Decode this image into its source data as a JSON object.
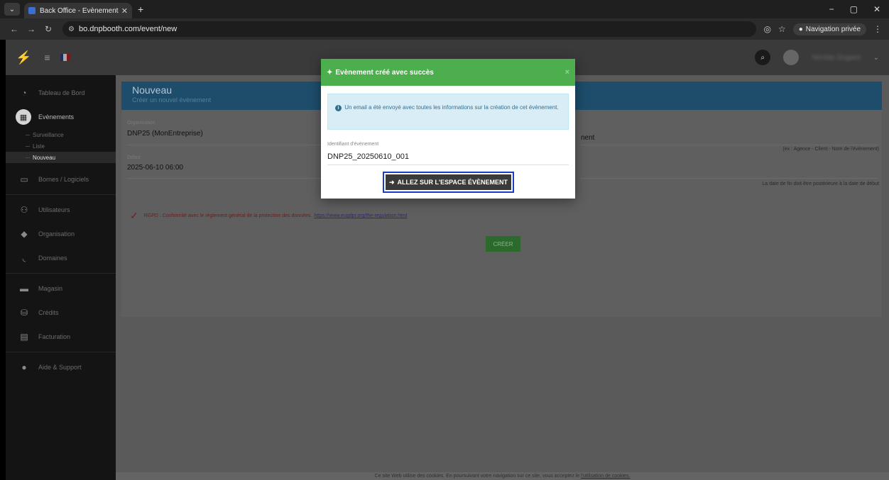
{
  "browser": {
    "tab_title": "Back Office - Evènements : Nou",
    "tab_close": "✕",
    "new_tab": "+",
    "url": "bo.dnpbooth.com/event/new",
    "private_label": "Navigation privée",
    "window_controls": [
      "−",
      "▢",
      "✕"
    ]
  },
  "topnav": {
    "logo_icon": "lightning-logo-icon",
    "menu_icon": "hamburger-icon",
    "flag_colors": [
      "#002395",
      "#ffffff",
      "#ed2939"
    ],
    "user_name": "Nicolas Dugard"
  },
  "sidebar": {
    "items": [
      {
        "label": "Tableau de Bord",
        "icon": "dashboard-icon"
      },
      {
        "label": "Evènements",
        "icon": "calendar-icon"
      },
      {
        "label": "Bornes / Logiciels",
        "icon": "monitor-icon"
      },
      {
        "label": "Utilisateurs",
        "icon": "users-icon"
      },
      {
        "label": "Organisation",
        "icon": "tags-icon"
      },
      {
        "label": "Domaines",
        "icon": "rss-icon"
      },
      {
        "label": "Magasin",
        "icon": "store-icon"
      },
      {
        "label": "Crédits",
        "icon": "coins-icon"
      },
      {
        "label": "Facturation",
        "icon": "invoice-icon"
      },
      {
        "label": "Aide & Support",
        "icon": "info-icon"
      }
    ],
    "subitems": [
      "Surveillance",
      "Liste",
      "Nouveau"
    ]
  },
  "panel": {
    "title": "Nouveau",
    "subtitle": "Créer un nouvel évènement",
    "org_label": "Organisation",
    "org_value": "DNP25 (MonEntreprise)",
    "name_partial": "nent",
    "name_hint": "(ex : Agence - Client - Nom de l'évènement)",
    "start_label": "Début",
    "start_value": "2025-06-10 06:00",
    "end_hint": "La date de fin doit être postérieure à la date de début",
    "rgpd_text": "RGPD : Conformité avec le règlement général de la protection des données.",
    "rgpd_link": "https://www.eugdpr.org/the-regulation.html",
    "create_label": "CRÉER"
  },
  "cookie": {
    "text": "Ce site Web utilise des cookies. En poursuivant votre navigation sur ce site, vous acceptez le",
    "link": "l'utilisation de cookies."
  },
  "modal": {
    "title": "Evènement créé avec succès",
    "close": "×",
    "info_text": "Un email a été envoyé avec toutes les informations sur la création de cet évènement.",
    "id_label": "Identifiant d'évènement",
    "id_value": "DNP25_20250610_001",
    "button_label": "ALLEZ SUR L'ESPACE ÉVÈNEMENT"
  }
}
